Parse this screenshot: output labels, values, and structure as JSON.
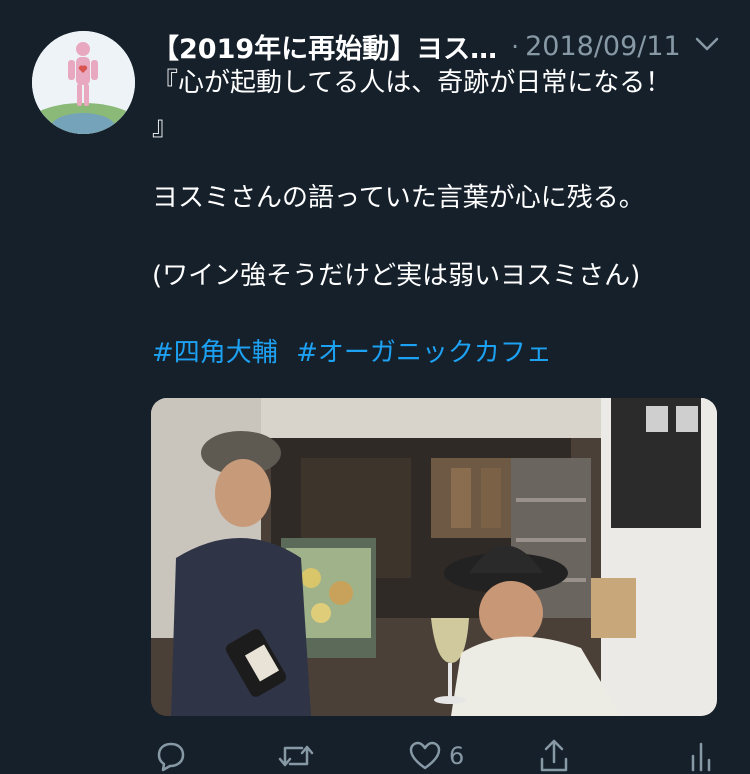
{
  "tweet": {
    "display_name": "【2019年に再始動】ヨス…",
    "separator": "·",
    "date": "2018/09/11",
    "lines": [
      "『心が起動してる人は、奇跡が日常になる！",
      "』",
      "ヨスミさんの語っていた言葉が心に残る。",
      "(ワイン強そうだけど実は弱いヨスミさん)"
    ],
    "hashtags": [
      "#四角大輔",
      "#オーガニックカフェ"
    ]
  },
  "actions": {
    "reply_icon": "reply-icon",
    "retweet_icon": "retweet-icon",
    "like_icon": "heart-icon",
    "like_count": "6",
    "share_icon": "share-icon",
    "analytics_icon": "analytics-icon"
  },
  "colors": {
    "background": "#15202b",
    "secondary_text": "#8899a6",
    "link": "#1da1f2"
  }
}
